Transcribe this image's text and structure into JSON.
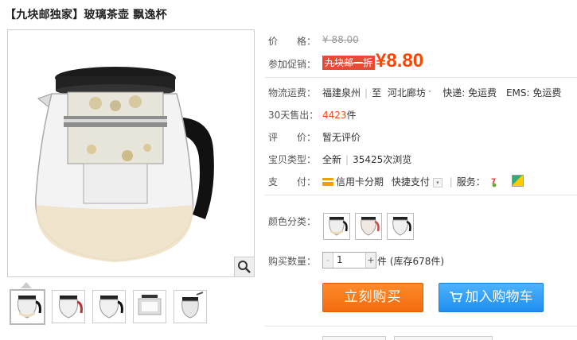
{
  "title": "【九块邮独家】玻璃茶壶 飘逸杯",
  "price": {
    "label": "价　　格：",
    "value": "¥ 88.00"
  },
  "promo": {
    "label": "参加促销：",
    "tag": "九块邮一折",
    "price": "¥8.80"
  },
  "shipping": {
    "label": "物流运费：",
    "from": "福建泉州",
    "to_label": "至",
    "to": "河北廊坊",
    "express": "快递: 免运费",
    "ems": "EMS: 免运费"
  },
  "sold": {
    "label": "30天售出：",
    "value": "4423",
    "unit": "件"
  },
  "rating": {
    "label": "评　　价：",
    "value": "暂无评价"
  },
  "item_type": {
    "label": "宝贝类型：",
    "value": "全新",
    "views": "35425次浏览"
  },
  "payment": {
    "label": "支　　付：",
    "option1": "信用卡分期",
    "option2": "快捷支付",
    "service_label": "服务："
  },
  "color": {
    "label": "颜色分类："
  },
  "quantity": {
    "label": "购买数量：",
    "value": "1",
    "unit": "件",
    "stock": "(库存678件)",
    "minus": "-",
    "plus": "+"
  },
  "actions": {
    "buy": "立刻购买",
    "cart": "加入购物车"
  },
  "colors": {
    "price": "#ff4400",
    "promo_tag": "#e64b35",
    "buy": "#f26c0f",
    "cart": "#1e8ef0"
  }
}
